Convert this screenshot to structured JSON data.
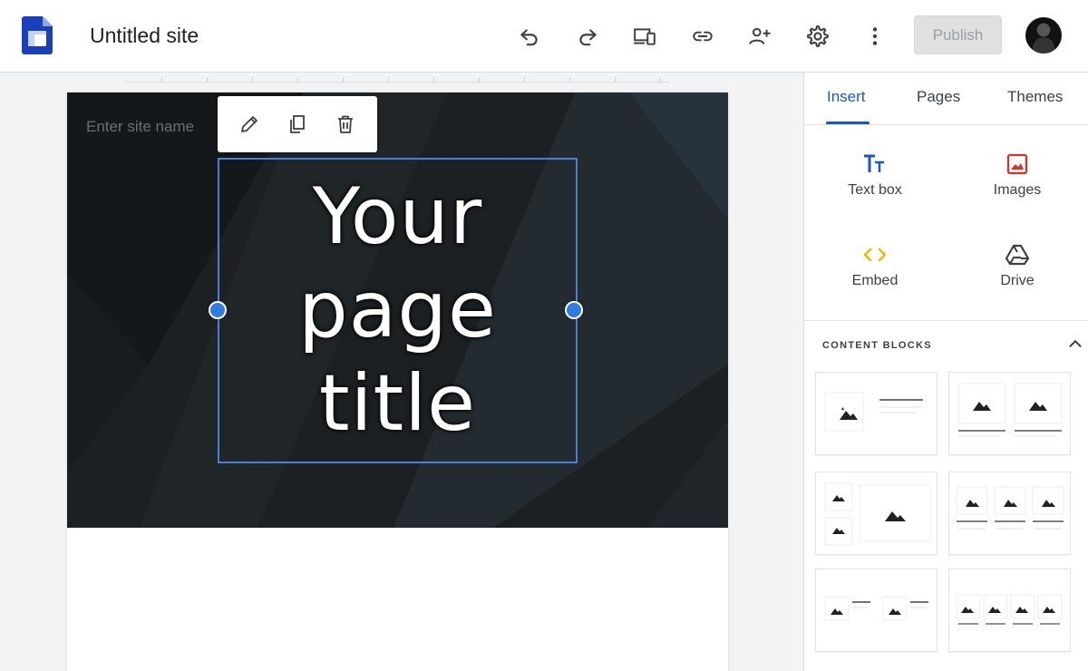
{
  "app": {
    "site_title": "Untitled site",
    "publish_label": "Publish"
  },
  "toolbar_icons": [
    "undo-icon",
    "redo-icon",
    "preview-devices-icon",
    "link-icon",
    "share-person-icon",
    "settings-icon",
    "more-vert-icon"
  ],
  "editor": {
    "site_name_placeholder": "Enter site name",
    "page_title_line1": "Your",
    "page_title_line2": "page",
    "page_title_line3": "title",
    "float_toolbar_icons": [
      "pencil-icon",
      "copy-icon",
      "trash-icon"
    ]
  },
  "panel": {
    "tabs": [
      {
        "label": "Insert",
        "active": true
      },
      {
        "label": "Pages",
        "active": false
      },
      {
        "label": "Themes",
        "active": false
      }
    ],
    "insert_items": [
      {
        "label": "Text box",
        "icon": "text-box-icon",
        "color": "#1a56c8"
      },
      {
        "label": "Images",
        "icon": "image-icon",
        "color": "#d93025"
      },
      {
        "label": "Embed",
        "icon": "embed-icon",
        "color": "#f2b600"
      },
      {
        "label": "Drive",
        "icon": "drive-icon",
        "color": "#3c4043"
      }
    ],
    "content_blocks_label": "CONTENT BLOCKS"
  },
  "colors": {
    "accent": "#1a56c8",
    "selection": "#4a7fd6",
    "handle": "#2f7de1",
    "header_bg": "#1c2023"
  }
}
